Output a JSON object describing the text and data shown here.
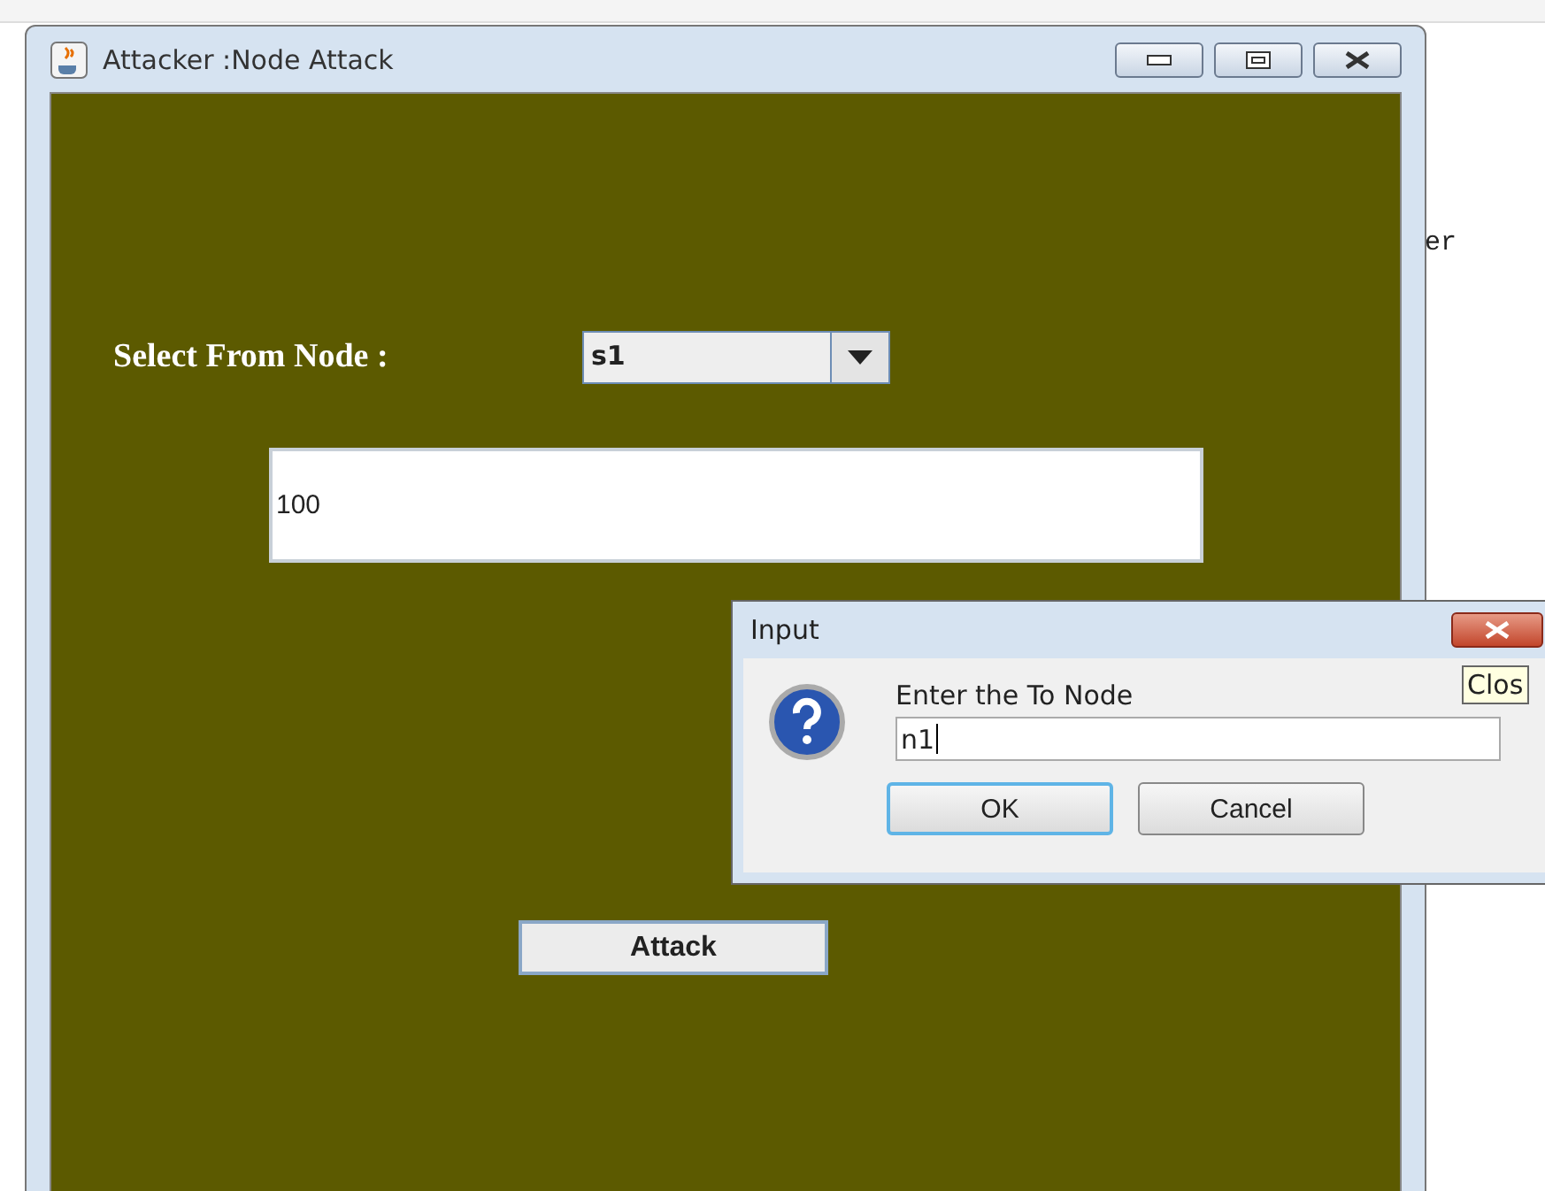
{
  "background": {
    "text": "er"
  },
  "window": {
    "title": "Attacker :Node Attack",
    "controls": [
      {
        "kind": "minimize"
      },
      {
        "kind": "maximize"
      },
      {
        "kind": "close"
      }
    ]
  },
  "form": {
    "from_label": "Select From Node :",
    "from_combo": {
      "value": "s1"
    },
    "value_field": {
      "value": "100"
    },
    "attack_button": "Attack"
  },
  "dialog": {
    "title": "Input",
    "prompt": "Enter the To Node",
    "input": {
      "value": "n1",
      "focused": true
    },
    "buttons": [
      {
        "label": "OK",
        "selected": true
      },
      {
        "label": "Cancel",
        "selected": false
      }
    ],
    "tooltip": "Clos"
  }
}
